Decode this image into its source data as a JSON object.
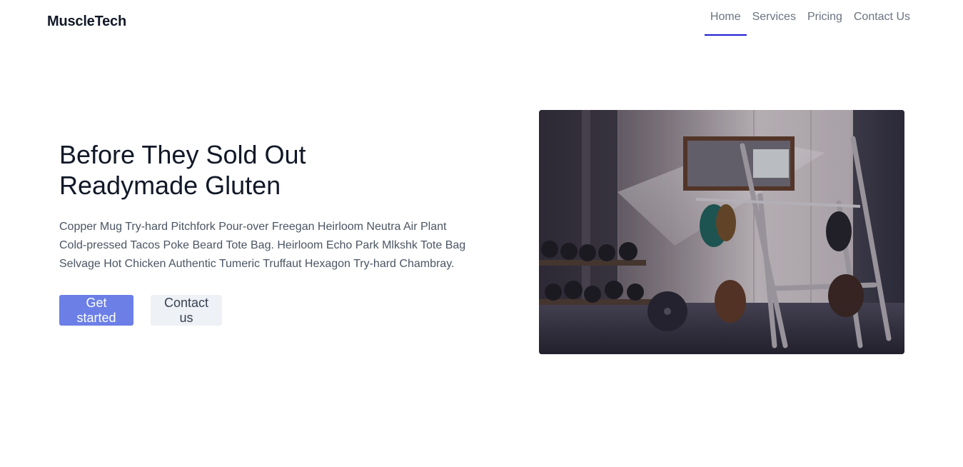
{
  "brand": {
    "name": "MuscleTech"
  },
  "nav": {
    "items": [
      {
        "label": "Home",
        "active": true
      },
      {
        "label": "Services",
        "active": false
      },
      {
        "label": "Pricing",
        "active": false
      },
      {
        "label": "Contact Us",
        "active": false
      }
    ]
  },
  "hero": {
    "title_lines": [
      "Before They Sold Out",
      "Readymade Gluten"
    ],
    "description_lines": [
      "Copper Mug Try-hard Pitchfork Pour-over Freegan Heirloom Neutra Air Plant",
      "Cold-pressed Tacos Poke Beard Tote Bag. Heirloom Echo Park Mlkshk Tote Bag",
      "Selvage Hot Chicken Authentic Tumeric Truffaut Hexagon Try-hard Chambray."
    ],
    "primary_button": "Get started",
    "secondary_button": "Contact us"
  },
  "colors": {
    "accent": "#6b7fe6",
    "nav_active_underline": "#1d1dd3",
    "secondary_button_bg": "#eef1f5"
  },
  "image": {
    "subject": "gym-weight-room-photo"
  }
}
